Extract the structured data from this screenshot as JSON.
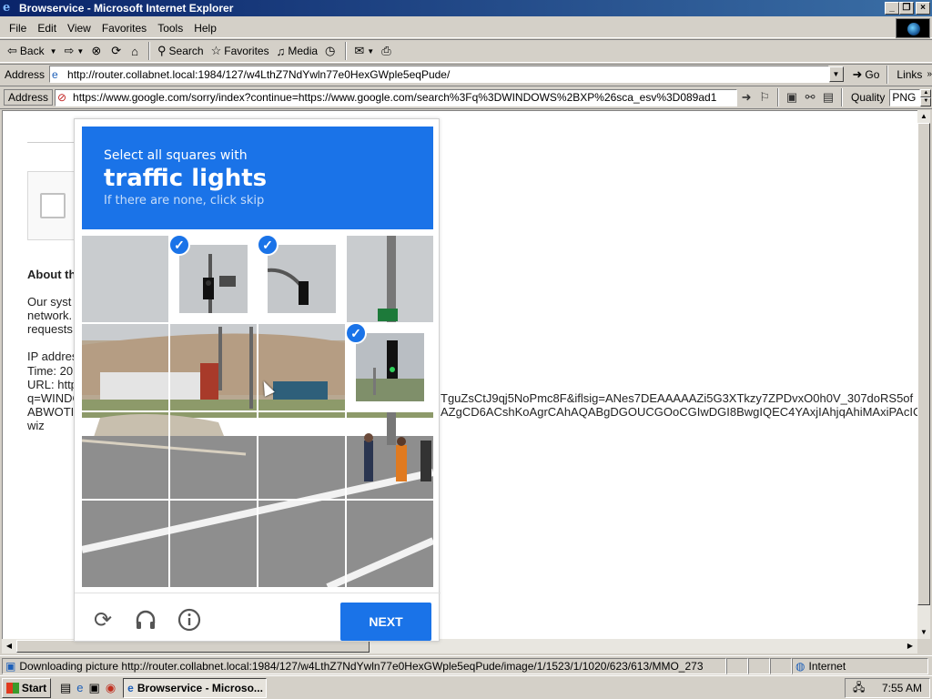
{
  "window": {
    "title": "Browservice - Microsoft Internet Explorer",
    "controls": [
      "_",
      "❐",
      "×"
    ]
  },
  "menubar": {
    "items": [
      "File",
      "Edit",
      "View",
      "Favorites",
      "Tools",
      "Help"
    ]
  },
  "toolbar": {
    "back": "Back",
    "search": "Search",
    "favorites": "Favorites",
    "media": "Media"
  },
  "address_bar": {
    "label": "Address",
    "url": "http://router.collabnet.local:1984/127/w4LthZ7NdYwln77e0HexGWple5eqPude/",
    "go": "Go",
    "links": "Links"
  },
  "inner_address_bar": {
    "label": "Address",
    "url": "https://www.google.com/sorry/index?continue=https://www.google.com/search%3Fq%3DWINDOWS%2BXP%26sca_esv%3D089ad1",
    "quality_label": "Quality",
    "quality_value": "PNG"
  },
  "page": {
    "about_heading": "About th",
    "text_lines": [
      "Our syst",
      "network.",
      "requests"
    ],
    "ip_line": "IP addres",
    "time_line": "Time: 20",
    "url_line": "URL: http",
    "q_line": "q=WINDO",
    "abw_line": "ABWOTI",
    "wiz_line": "wiz",
    "long_line1": "TguZsCtJ9qj5NoPmc8F&iflsig=ANes7DEAAAAAZi5G3XTkzy7ZPDvxO0h0V_307doRS5of",
    "long_line2": "AZgCD6ACshKoAgrCAhAQABgDGOUCGOoCGIwDGI8BwgIQEC4YAxjIAhjqAhiMAxiPAcIC"
  },
  "captcha": {
    "instruction": "Select all squares with",
    "target": "traffic lights",
    "hint": "If there are none, click skip",
    "selected_tiles": [
      1,
      2,
      7
    ],
    "next_label": "NEXT",
    "reload_icon": "reload-icon",
    "audio_icon": "headphones-icon",
    "info_icon": "info-icon"
  },
  "status_bar": {
    "text": "Downloading picture http://router.collabnet.local:1984/127/w4LthZ7NdYwln77e0HexGWple5eqPude/image/1/1523/1/1020/623/613/MMO_273",
    "zone": "Internet"
  },
  "taskbar": {
    "start": "Start",
    "task": "Browservice - Microso...",
    "clock": "7:55 AM"
  }
}
